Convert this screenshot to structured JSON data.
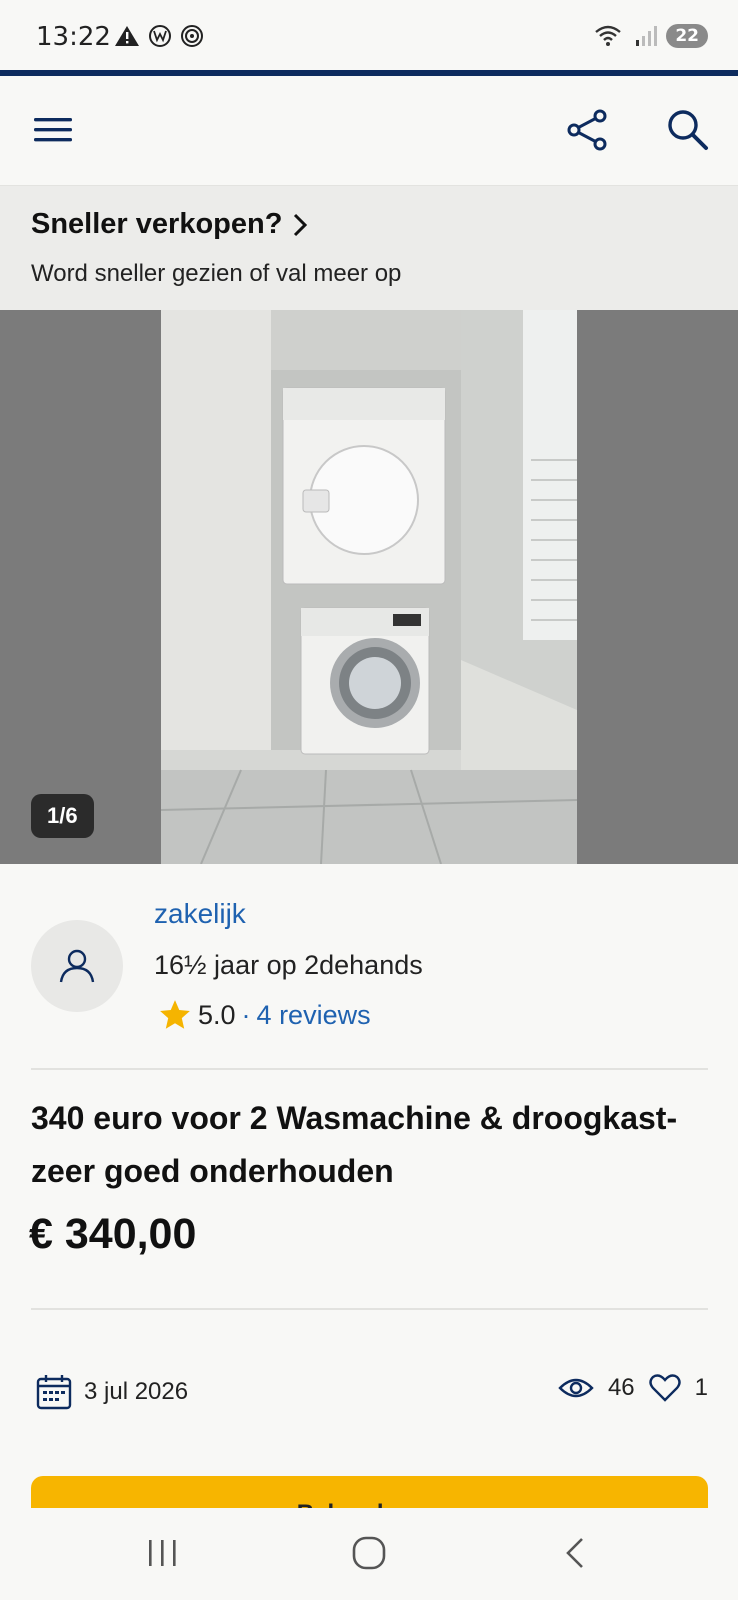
{
  "status_bar": {
    "time": "13:22",
    "battery": "22"
  },
  "promo": {
    "title": "Sneller verkopen?",
    "subtitle": "Word sneller gezien of val meer op"
  },
  "gallery": {
    "counter": "1/6"
  },
  "seller": {
    "name": "zakelijk",
    "membership": "16½ jaar op 2dehands",
    "rating": "5.0",
    "separator": "·",
    "reviews": "4 reviews"
  },
  "listing": {
    "title": "340 euro voor 2 Wasmachine & droogkast-zeer goed onderhouden",
    "price": "€ 340,00"
  },
  "meta": {
    "date": "3 jul 2026",
    "views": "46",
    "favorites": "1"
  },
  "cta": {
    "label": "Bel verkoper"
  },
  "colors": {
    "navy": "#0d2b5e",
    "link_blue": "#1f62b0",
    "cta_yellow": "#f7b500",
    "star": "#f5b400"
  }
}
